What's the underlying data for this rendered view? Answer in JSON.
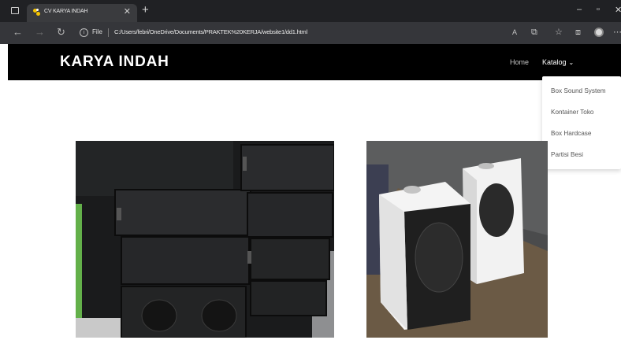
{
  "browser": {
    "tab_title": "CV KARYA INDAH",
    "file_label": "File",
    "url": "C:/Users/febri/OneDrive/Documents/PRAKTEK%20KERJA/website1/dd1.html"
  },
  "site": {
    "brand": "KARYA INDAH",
    "nav": {
      "home": "Home",
      "katalog": "Katalog"
    },
    "dropdown": [
      "Box Sound System",
      "Kontainer Toko",
      "Box Hardcase",
      "Partisi Besi"
    ]
  },
  "products": [
    {
      "image": "line-array-speaker-boxes-black"
    },
    {
      "image": "white-speaker-cabinets"
    }
  ],
  "colors": {
    "navbar": "#000000",
    "browser_tabbar": "#202124",
    "browser_toolbar": "#35363a"
  }
}
